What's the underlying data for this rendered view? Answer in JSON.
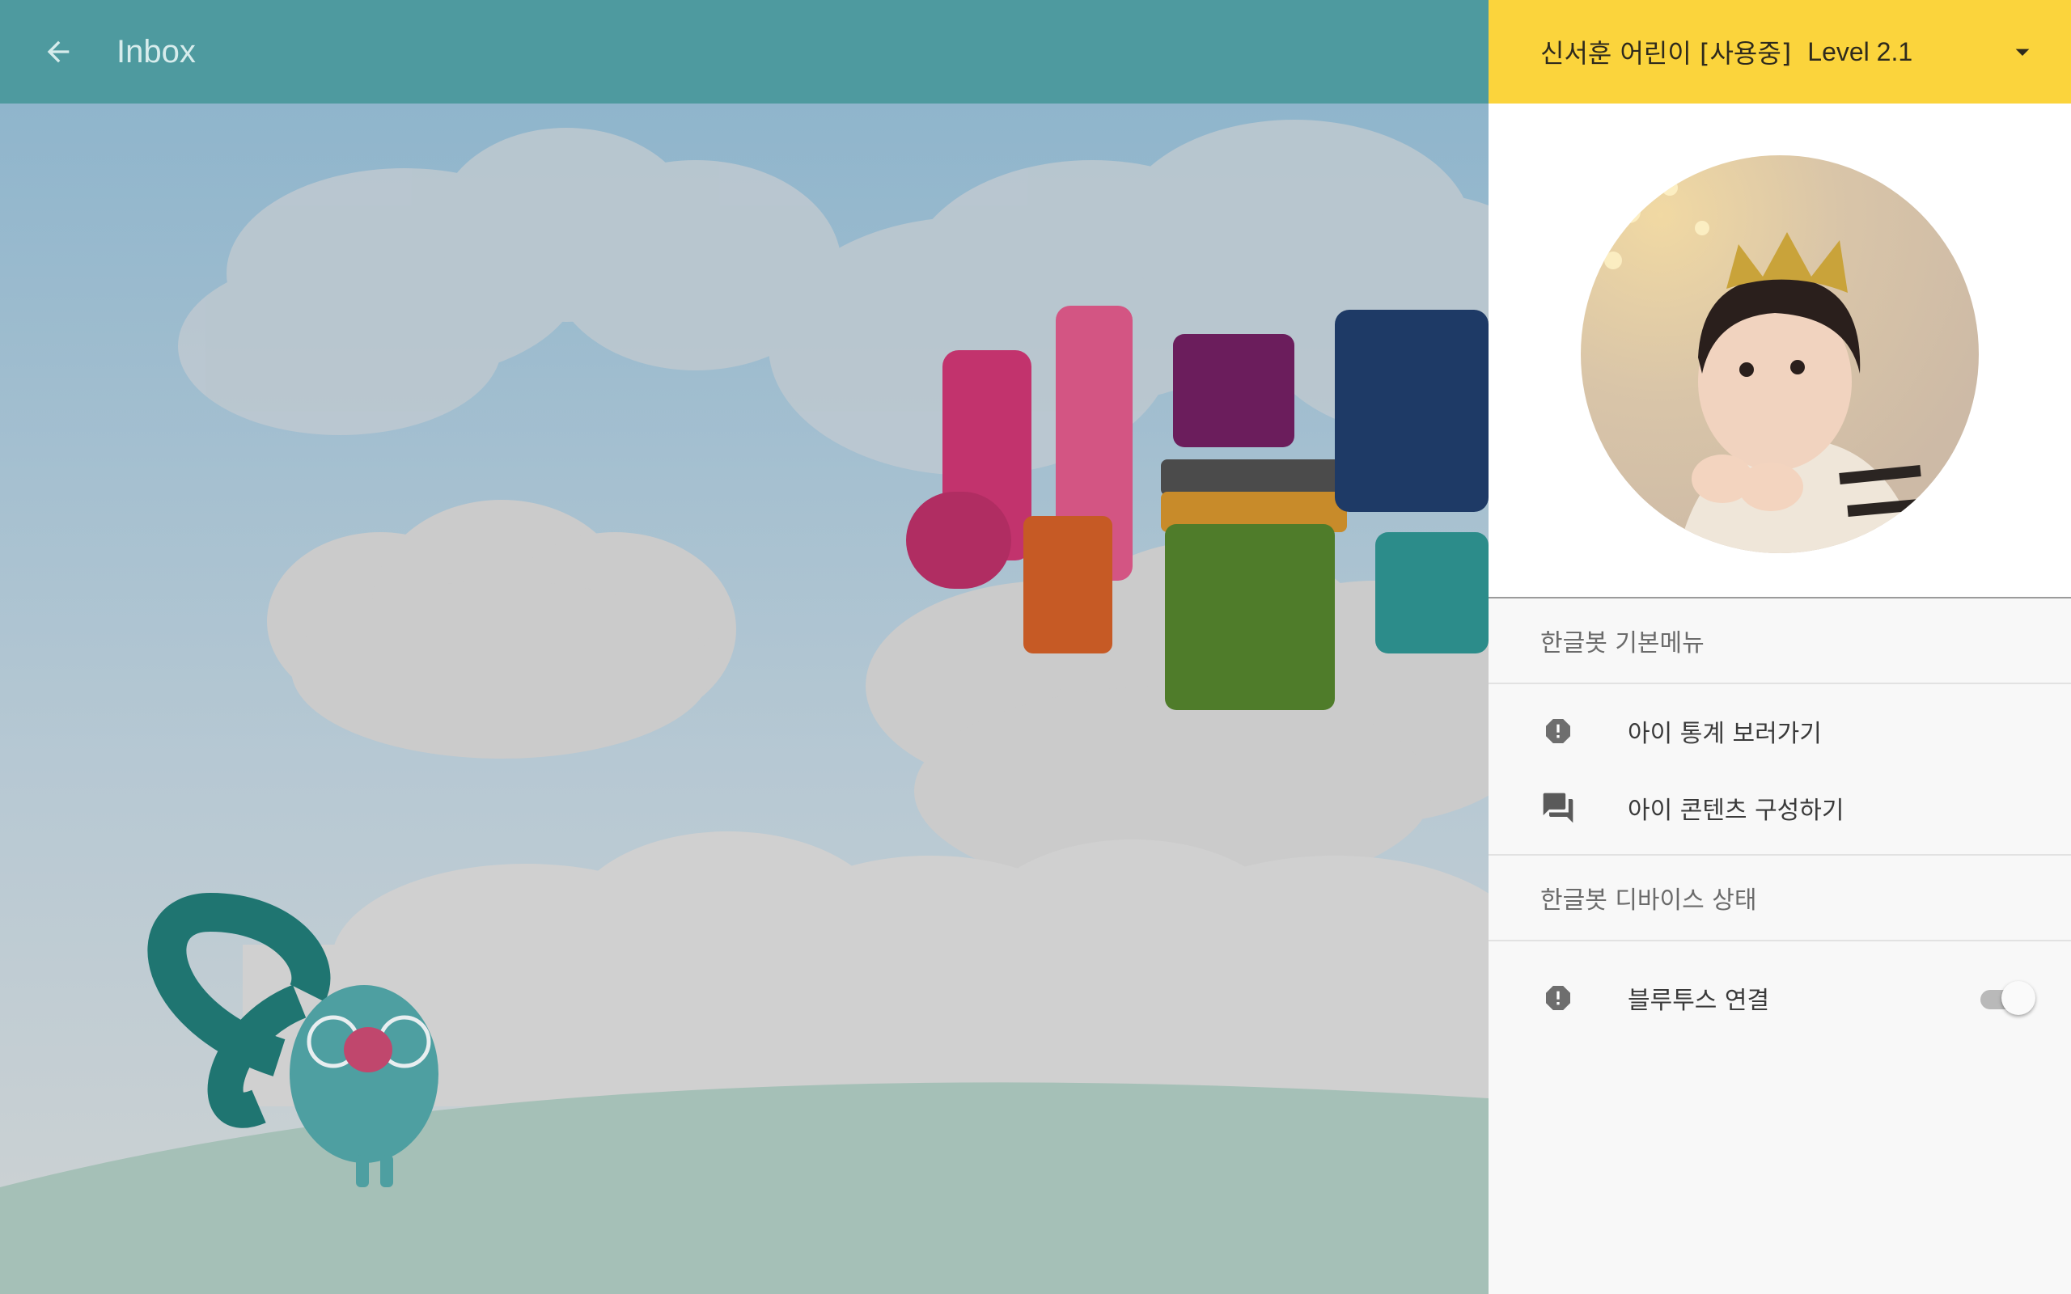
{
  "appbar": {
    "back_icon": "arrow-back-icon",
    "title": "Inbox",
    "background": "#4e9a9f"
  },
  "drawer": {
    "account": {
      "name": "신서훈 어린이 [사용중]",
      "level": "Level 2.1",
      "dropdown_icon": "arrow-drop-down-icon",
      "background": "#fbd43c"
    },
    "sections": [
      {
        "title": "한글봇 기본메뉴",
        "items": [
          {
            "label": "아이 통계 보러가기",
            "icon": "alert-icon"
          },
          {
            "label": "아이 콘텐츠 구성하기",
            "icon": "chat-icon"
          }
        ]
      },
      {
        "title": "한글봇 디바이스 상태",
        "items": [
          {
            "label": "블루투스 연결",
            "icon": "alert-icon",
            "toggle": "off"
          }
        ]
      }
    ]
  }
}
